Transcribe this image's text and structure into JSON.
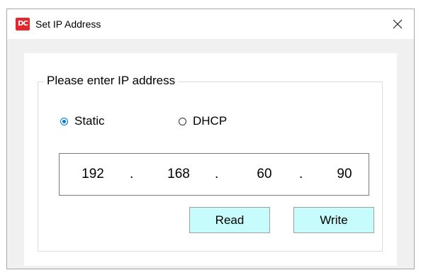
{
  "window": {
    "title": "Set IP Address",
    "icon_name": "app-logo-icon",
    "icon_text": "DC",
    "icon_color": "#e2282d",
    "close_glyph": "✕"
  },
  "group": {
    "title": "Please enter IP address"
  },
  "mode": {
    "options": [
      {
        "label": "Static",
        "selected": true
      },
      {
        "label": "DHCP",
        "selected": false
      }
    ]
  },
  "ip": {
    "octets": [
      "192",
      "168",
      "60",
      "90"
    ],
    "separator": "."
  },
  "buttons": {
    "read": "Read",
    "write": "Write",
    "background": "#c6fcfc"
  },
  "colors": {
    "radio_accent": "#0078d7"
  }
}
